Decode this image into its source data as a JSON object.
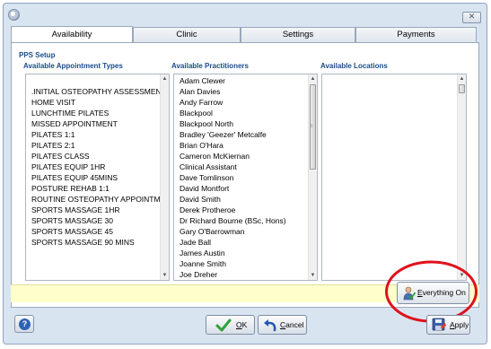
{
  "window": {
    "close_glyph": "✕"
  },
  "tabs": [
    {
      "label": "Availability"
    },
    {
      "label": "Clinic"
    },
    {
      "label": "Settings"
    },
    {
      "label": "Payments"
    }
  ],
  "section_title": "PPS Setup",
  "columns": {
    "appointment_types": {
      "header": "Available Appointment Types",
      "items": [
        ".INITIAL OSTEOPATHY ASSESSMEN",
        "HOME VISIT",
        "LUNCHTIME PILATES",
        "MISSED APPOINTMENT",
        "PILATES 1:1",
        "PILATES 2:1",
        "PILATES CLASS",
        "PILATES EQUIP 1HR",
        "PILATES EQUIP 45MINS",
        "POSTURE REHAB 1:1",
        "ROUTINE OSTEOPATHY APPOINTM",
        "SPORTS MASSAGE 1HR",
        "SPORTS MASSAGE 30",
        "SPORTS MASSAGE 45",
        "SPORTS MASSAGE 90 MINS"
      ]
    },
    "practitioners": {
      "header": "Available Practitioners",
      "items": [
        "Adam Clewer",
        "Alan Davies",
        "Andy Farrow",
        "Blackpool",
        "Blackpool North",
        "Bradley 'Geezer' Metcalfe",
        "Brian O'Hara",
        "Cameron McKiernan",
        "Clinical Assistant",
        "Dave Tomlinson",
        "David Montfort",
        "David Smith",
        "Derek Protheroe",
        "Dr Richard Bourne (BSc, Hons)",
        "Gary O'Barrowman",
        "Jade Ball",
        "James Austin",
        "Joanne Smith",
        "Joe Dreher"
      ]
    },
    "locations": {
      "header": "Available Locations",
      "items": []
    }
  },
  "everything_on": {
    "first": "E",
    "rest": "verything On",
    "icon": "person-check-icon"
  },
  "buttons": {
    "help_glyph": "?",
    "ok_first": "O",
    "ok_rest": "K",
    "cancel_first": "C",
    "cancel_rest": "ancel",
    "apply_first": "A",
    "apply_rest": "pply"
  },
  "icons": {
    "scroll_up": "▲",
    "scroll_down": "▼",
    "grip": "≡"
  },
  "colors": {
    "header_blue": "#1a4c8b",
    "info_bar": "#ffffcc",
    "highlight_red": "#e0101a"
  }
}
